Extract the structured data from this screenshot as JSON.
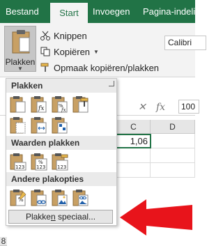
{
  "tabs": [
    {
      "label": "Bestand",
      "active": false
    },
    {
      "label": "Start",
      "active": true
    },
    {
      "label": "Invoegen",
      "active": false
    },
    {
      "label": "Pagina-indeling",
      "active": false
    }
  ],
  "clipboard": {
    "paste_label": "Plakken",
    "cut_label": "Knippen",
    "copy_label": "Kopiëren",
    "format_painter_label": "Opmaak kopiëren/plakken"
  },
  "font": {
    "name": "Calibri"
  },
  "formula_bar": {
    "namebox_value": "100"
  },
  "grid": {
    "columns": [
      "C",
      "D"
    ],
    "rows": [
      "8"
    ],
    "selected_cell_value": "1,06"
  },
  "menu": {
    "section_paste": "Plakken",
    "section_values": "Waarden plakken",
    "section_other": "Andere plakopties",
    "paste_special_label": "Plakken speciaal...",
    "paste_special_prefix": "Plakke",
    "paste_special_underlined": "n",
    "paste_special_suffix": " speciaal...",
    "badge_123": "123",
    "badge_pct": "%",
    "badge_fx": "fx"
  },
  "colors": {
    "excel_green": "#217346",
    "arrow_red": "#e8141b"
  }
}
